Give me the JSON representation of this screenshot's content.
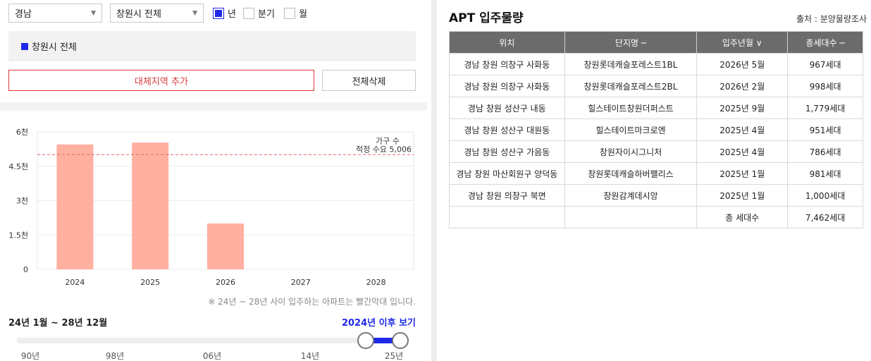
{
  "filters": {
    "province": "경남",
    "city": "창원시 전체",
    "periods": [
      {
        "label": "년",
        "checked": true
      },
      {
        "label": "분기",
        "checked": false
      },
      {
        "label": "월",
        "checked": false
      }
    ]
  },
  "region": {
    "label": "창원시 전체",
    "color": "#1f2ae8"
  },
  "buttons": {
    "add_region": "대체지역 추가",
    "delete_all": "전체삭제"
  },
  "chart_data": {
    "type": "bar",
    "categories": [
      "2024",
      "2025",
      "2026",
      "2027",
      "2028"
    ],
    "values": [
      5450,
      5530,
      2000,
      0,
      0
    ],
    "ylim": [
      0,
      6000
    ],
    "ytick_labels": [
      "0",
      "1.5천",
      "3천",
      "4.5천",
      "6천"
    ],
    "ytick_values": [
      0,
      1500,
      3000,
      4500,
      6000
    ],
    "reference_line": {
      "value": 5006,
      "label": "적정 수요 5,006",
      "color": "#e06666"
    },
    "series_label": "가구 수",
    "bar_color": "#ffb0a0",
    "grid": true
  },
  "note": "※ 24년 ~ 28년 사이 입주하는 아파트는 빨간막대 입니다.",
  "range": {
    "title": "24년 1월 ~ 28년 12월",
    "link": "2024년 이후 보기",
    "ticks": [
      "90년",
      "98년",
      "06년",
      "14년",
      "25년"
    ],
    "selected_fraction": [
      0.9,
      1.0
    ]
  },
  "panel": {
    "title": "APT 입주물량",
    "source": "출처 : 분양물량조사",
    "columns": [
      "위치",
      "단지명 ─",
      "입주년월 ∨",
      "총세대수 ─"
    ],
    "rows": [
      [
        "경남 창원 의창구 사화동",
        "창원롯데캐슬포레스트1BL",
        "2026년 5월",
        "967세대"
      ],
      [
        "경남 창원 의창구 사화동",
        "창원롯데캐슬포레스트2BL",
        "2026년 2월",
        "998세대"
      ],
      [
        "경남 창원 성산구 내동",
        "힐스테이트창원더퍼스트",
        "2025년 9월",
        "1,779세대"
      ],
      [
        "경남 창원 성산구 대원동",
        "힐스테이트마크로엔",
        "2025년 4월",
        "951세대"
      ],
      [
        "경남 창원 성산구 가음동",
        "창원자이시그니처",
        "2025년 4월",
        "786세대"
      ],
      [
        "경남 창원 마산회원구 양덕동",
        "창원롯데캐슬하버팰리스",
        "2025년 1월",
        "981세대"
      ],
      [
        "경남 창원 의창구 북면",
        "창원감계데시앙",
        "2025년 1월",
        "1,000세대"
      ]
    ],
    "total_label": "총 세대수",
    "total_value": "7,462세대"
  }
}
